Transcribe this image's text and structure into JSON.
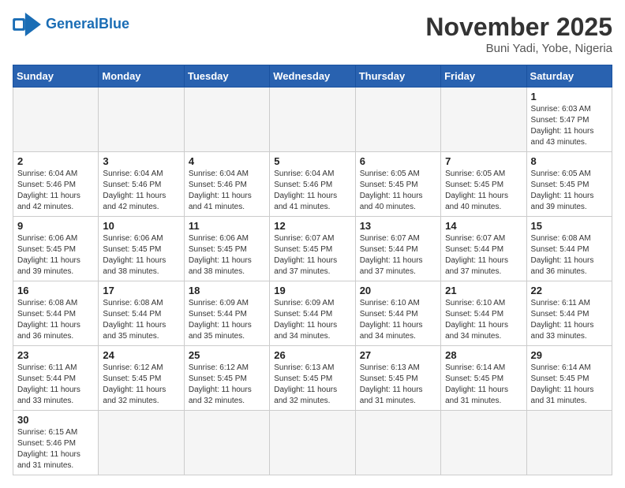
{
  "header": {
    "logo_general": "General",
    "logo_blue": "Blue",
    "month_title": "November 2025",
    "location": "Buni Yadi, Yobe, Nigeria"
  },
  "weekdays": [
    "Sunday",
    "Monday",
    "Tuesday",
    "Wednesday",
    "Thursday",
    "Friday",
    "Saturday"
  ],
  "weeks": [
    [
      {
        "day": "",
        "info": ""
      },
      {
        "day": "",
        "info": ""
      },
      {
        "day": "",
        "info": ""
      },
      {
        "day": "",
        "info": ""
      },
      {
        "day": "",
        "info": ""
      },
      {
        "day": "",
        "info": ""
      },
      {
        "day": "1",
        "info": "Sunrise: 6:03 AM\nSunset: 5:47 PM\nDaylight: 11 hours and 43 minutes."
      }
    ],
    [
      {
        "day": "2",
        "info": "Sunrise: 6:04 AM\nSunset: 5:46 PM\nDaylight: 11 hours and 42 minutes."
      },
      {
        "day": "3",
        "info": "Sunrise: 6:04 AM\nSunset: 5:46 PM\nDaylight: 11 hours and 42 minutes."
      },
      {
        "day": "4",
        "info": "Sunrise: 6:04 AM\nSunset: 5:46 PM\nDaylight: 11 hours and 41 minutes."
      },
      {
        "day": "5",
        "info": "Sunrise: 6:04 AM\nSunset: 5:46 PM\nDaylight: 11 hours and 41 minutes."
      },
      {
        "day": "6",
        "info": "Sunrise: 6:05 AM\nSunset: 5:45 PM\nDaylight: 11 hours and 40 minutes."
      },
      {
        "day": "7",
        "info": "Sunrise: 6:05 AM\nSunset: 5:45 PM\nDaylight: 11 hours and 40 minutes."
      },
      {
        "day": "8",
        "info": "Sunrise: 6:05 AM\nSunset: 5:45 PM\nDaylight: 11 hours and 39 minutes."
      }
    ],
    [
      {
        "day": "9",
        "info": "Sunrise: 6:06 AM\nSunset: 5:45 PM\nDaylight: 11 hours and 39 minutes."
      },
      {
        "day": "10",
        "info": "Sunrise: 6:06 AM\nSunset: 5:45 PM\nDaylight: 11 hours and 38 minutes."
      },
      {
        "day": "11",
        "info": "Sunrise: 6:06 AM\nSunset: 5:45 PM\nDaylight: 11 hours and 38 minutes."
      },
      {
        "day": "12",
        "info": "Sunrise: 6:07 AM\nSunset: 5:45 PM\nDaylight: 11 hours and 37 minutes."
      },
      {
        "day": "13",
        "info": "Sunrise: 6:07 AM\nSunset: 5:44 PM\nDaylight: 11 hours and 37 minutes."
      },
      {
        "day": "14",
        "info": "Sunrise: 6:07 AM\nSunset: 5:44 PM\nDaylight: 11 hours and 37 minutes."
      },
      {
        "day": "15",
        "info": "Sunrise: 6:08 AM\nSunset: 5:44 PM\nDaylight: 11 hours and 36 minutes."
      }
    ],
    [
      {
        "day": "16",
        "info": "Sunrise: 6:08 AM\nSunset: 5:44 PM\nDaylight: 11 hours and 36 minutes."
      },
      {
        "day": "17",
        "info": "Sunrise: 6:08 AM\nSunset: 5:44 PM\nDaylight: 11 hours and 35 minutes."
      },
      {
        "day": "18",
        "info": "Sunrise: 6:09 AM\nSunset: 5:44 PM\nDaylight: 11 hours and 35 minutes."
      },
      {
        "day": "19",
        "info": "Sunrise: 6:09 AM\nSunset: 5:44 PM\nDaylight: 11 hours and 34 minutes."
      },
      {
        "day": "20",
        "info": "Sunrise: 6:10 AM\nSunset: 5:44 PM\nDaylight: 11 hours and 34 minutes."
      },
      {
        "day": "21",
        "info": "Sunrise: 6:10 AM\nSunset: 5:44 PM\nDaylight: 11 hours and 34 minutes."
      },
      {
        "day": "22",
        "info": "Sunrise: 6:11 AM\nSunset: 5:44 PM\nDaylight: 11 hours and 33 minutes."
      }
    ],
    [
      {
        "day": "23",
        "info": "Sunrise: 6:11 AM\nSunset: 5:44 PM\nDaylight: 11 hours and 33 minutes."
      },
      {
        "day": "24",
        "info": "Sunrise: 6:12 AM\nSunset: 5:45 PM\nDaylight: 11 hours and 32 minutes."
      },
      {
        "day": "25",
        "info": "Sunrise: 6:12 AM\nSunset: 5:45 PM\nDaylight: 11 hours and 32 minutes."
      },
      {
        "day": "26",
        "info": "Sunrise: 6:13 AM\nSunset: 5:45 PM\nDaylight: 11 hours and 32 minutes."
      },
      {
        "day": "27",
        "info": "Sunrise: 6:13 AM\nSunset: 5:45 PM\nDaylight: 11 hours and 31 minutes."
      },
      {
        "day": "28",
        "info": "Sunrise: 6:14 AM\nSunset: 5:45 PM\nDaylight: 11 hours and 31 minutes."
      },
      {
        "day": "29",
        "info": "Sunrise: 6:14 AM\nSunset: 5:45 PM\nDaylight: 11 hours and 31 minutes."
      }
    ],
    [
      {
        "day": "30",
        "info": "Sunrise: 6:15 AM\nSunset: 5:46 PM\nDaylight: 11 hours and 31 minutes."
      },
      {
        "day": "",
        "info": ""
      },
      {
        "day": "",
        "info": ""
      },
      {
        "day": "",
        "info": ""
      },
      {
        "day": "",
        "info": ""
      },
      {
        "day": "",
        "info": ""
      },
      {
        "day": "",
        "info": ""
      }
    ]
  ]
}
